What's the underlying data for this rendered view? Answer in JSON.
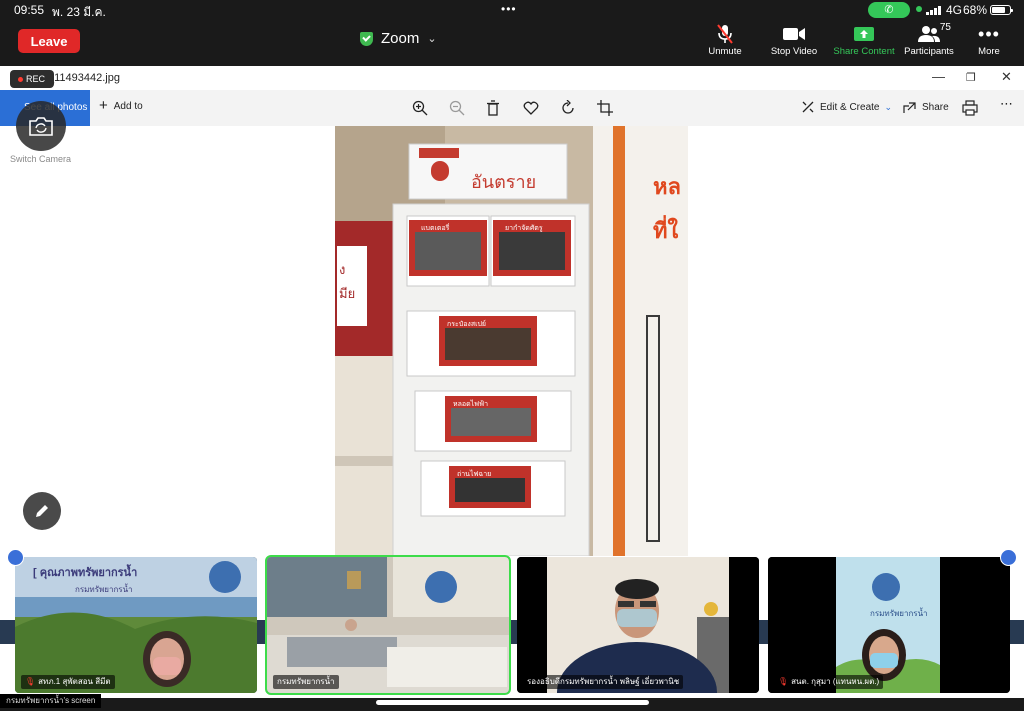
{
  "status_bar": {
    "time": "09:55",
    "date": "พ. 23 มี.ค.",
    "network": "4G",
    "battery": "68%",
    "battery_level": 0.68
  },
  "toolbar": {
    "leave_label": "Leave",
    "app_title": "Zoom",
    "unmute_label": "Unmute",
    "stop_video_label": "Stop Video",
    "share_content_label": "Share Content",
    "participants_label": "Participants",
    "participants_count": "75",
    "more_label": "More"
  },
  "shared_window": {
    "rec_label": "REC",
    "file_name": "_11493442.jpg",
    "see_all_label": "See all photos",
    "add_to_label": "Add to",
    "edit_create_label": "Edit & Create",
    "share_label": "Share",
    "switch_camera_label": "Switch Camera"
  },
  "photo": {
    "top_sign": "อันตราย",
    "wall_text_1": "หล",
    "wall_text_2": "ที่ใ",
    "box_text_1": "ง",
    "box_text_2": "มีย",
    "drawer_labels": [
      "แบตเตอรี่",
      "ยากำจัดศัตรู",
      "กระป๋องสเปย์",
      "หลอดไฟฟ้า",
      "ถ่านไฟฉาย"
    ]
  },
  "participants": [
    {
      "name": "สทภ.1 สุพัตสอน สีมีต",
      "muted": true,
      "banner": "[ คุณภาพทรัพยากรน้ำ",
      "banner_sub": "กรมทรัพยากรน้ำ"
    },
    {
      "name": "กรมทรัพยากรน้ำ",
      "muted": false
    },
    {
      "name": "รองอธิบดีกรมทรัพยากรน้ำ พลิษฐ์ เอี่ยวพานิช",
      "muted": false
    },
    {
      "name": "สนต. กุสุมา (แทนหน.ผต.)",
      "muted": true,
      "banner": "กรมทรัพยากรน้ำ"
    }
  ],
  "screen_owner_label": "กรมทรัพยากรน้ำ's screen"
}
